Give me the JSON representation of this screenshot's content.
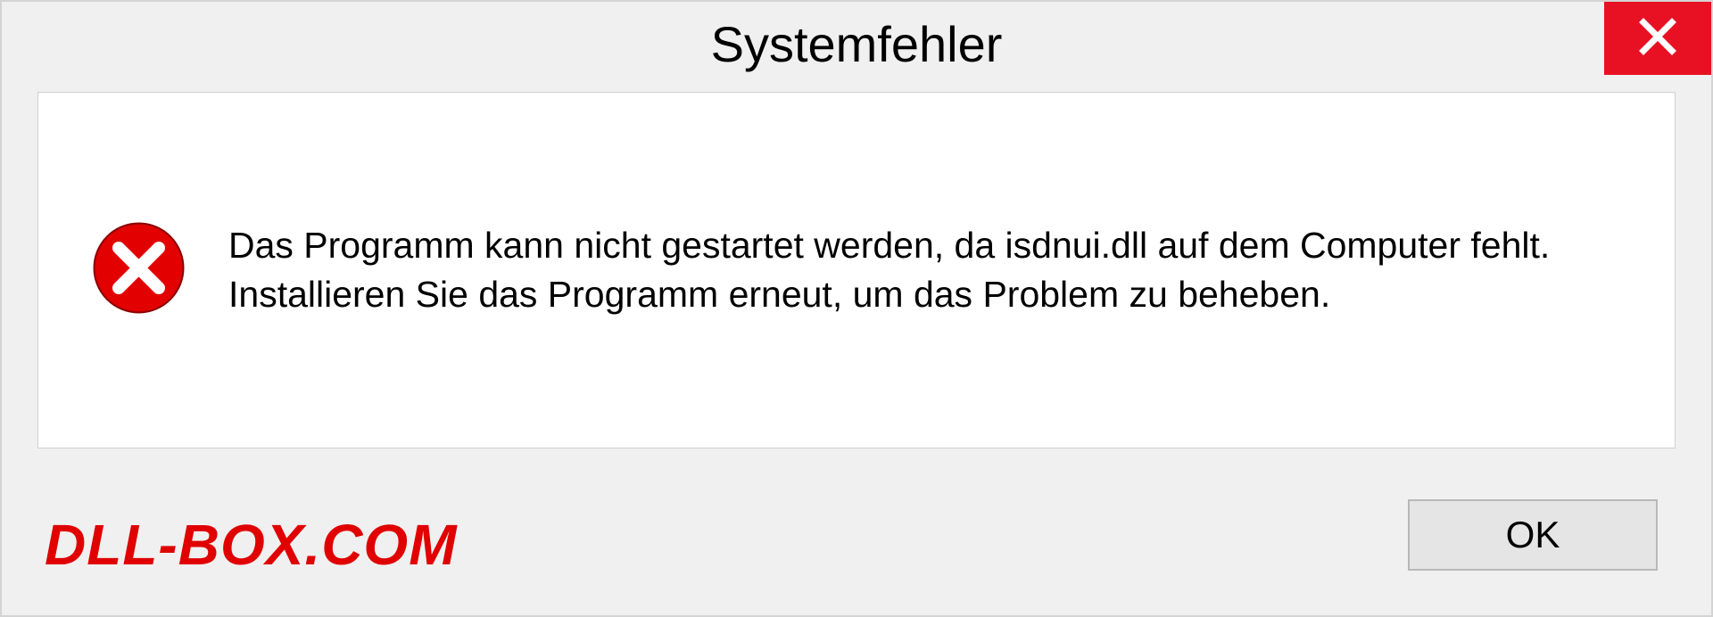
{
  "dialog": {
    "title": "Systemfehler",
    "message": "Das Programm kann nicht gestartet werden, da isdnui.dll auf dem Computer fehlt. Installieren Sie das Programm erneut, um das Problem zu beheben.",
    "ok_label": "OK"
  },
  "watermark": "DLL-BOX.COM"
}
